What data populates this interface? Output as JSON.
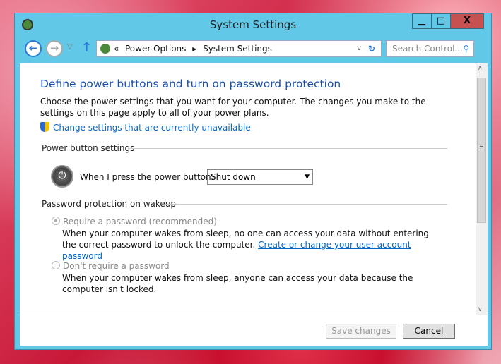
{
  "window": {
    "title": "System Settings",
    "minimize": "▁",
    "maximize": "□",
    "close": "X"
  },
  "nav": {
    "back": "←",
    "forward": "→",
    "recent": "▽",
    "up": "↑",
    "breadcrumb_prefix": "«",
    "breadcrumb": [
      "Power Options",
      "System Settings"
    ],
    "sep": "▸",
    "dropdown": "v",
    "refresh": "↻",
    "search_placeholder": "Search Control...",
    "search_icon": "⚲"
  },
  "main": {
    "heading": "Define power buttons and turn on password protection",
    "intro": "Choose the power settings that you want for your computer. The changes you make to the settings on this page apply to all of your power plans.",
    "change_link": "Change settings that are currently unavailable",
    "power_section": "Power button settings",
    "power_label": "When I press the power button:",
    "power_value": "Shut down",
    "password_section": "Password protection on wakeup",
    "require_label": "Require a password (recommended)",
    "require_desc": "When your computer wakes from sleep, no one can access your data without entering the correct password to unlock the computer.",
    "require_link": "Create or change your user account password",
    "norequire_label": "Don't require a password",
    "norequire_desc": "When your computer wakes from sleep, anyone can access your data because the computer isn't locked.",
    "selected": "require"
  },
  "footer": {
    "save": "Save changes",
    "cancel": "Cancel"
  },
  "colors": {
    "titlebar": "#62c8e8",
    "close": "#c75050",
    "heading": "#1a4fa8",
    "link": "#0066cc"
  }
}
